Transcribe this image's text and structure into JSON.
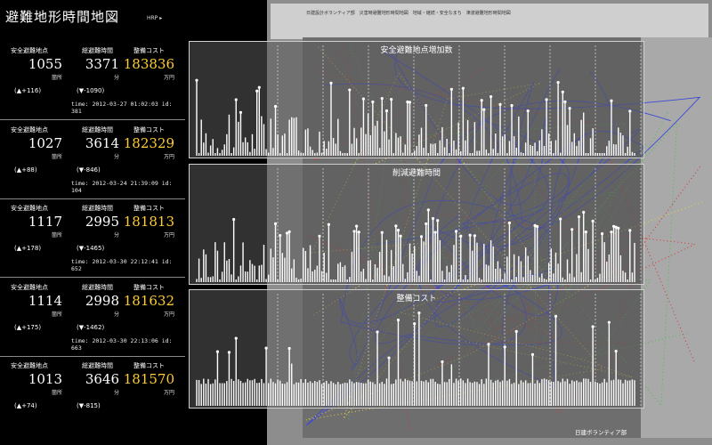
{
  "app": {
    "title": "避難地形時間地図",
    "subtitle": "HRP ▸"
  },
  "colors": {
    "accent": "#ffcc33",
    "bar": "#ffffff",
    "map_red": "#d93030",
    "map_blue": "#3b49d8",
    "map_green": "#48c048"
  },
  "labels": {
    "points": "安全避難地点",
    "time": "総避難時間",
    "cost": "整備コスト"
  },
  "units": {
    "points": "箇所",
    "time": "分",
    "cost": "万円"
  },
  "records": [
    {
      "points": "1055",
      "time": "3371",
      "cost": "183836",
      "delta_pos": "(▲+116)",
      "delta_neg": "(▼-1090)",
      "timestamp": "time: 2012-03-27 01:02:03 id: 381"
    },
    {
      "points": "1027",
      "time": "3614",
      "cost": "182329",
      "delta_pos": "(▲+88)",
      "delta_neg": "(▼-846)",
      "timestamp": "time: 2012-03-24 21:39:09 id: 104"
    },
    {
      "points": "1117",
      "time": "2995",
      "cost": "181813",
      "delta_pos": "(▲+178)",
      "delta_neg": "(▼-1465)",
      "timestamp": "time: 2012-03-30 22:12:41 id: 652"
    },
    {
      "points": "1114",
      "time": "2998",
      "cost": "181632",
      "delta_pos": "(▲+175)",
      "delta_neg": "(▼-1462)",
      "timestamp": "time: 2012-03-30 22:13:06 id: 663"
    },
    {
      "points": "1013",
      "time": "3646",
      "cost": "181570",
      "delta_pos": "(▲+74)",
      "delta_neg": "(▼-815)",
      "timestamp": ""
    }
  ],
  "charts": [
    {
      "title": "安全避難地点増加数"
    },
    {
      "title": "削減避難時間"
    },
    {
      "title": "整備コスト"
    }
  ],
  "chart_data": [
    {
      "type": "bar",
      "title": "安全避難地点増加数",
      "bar_count": 190
    },
    {
      "type": "bar",
      "title": "削減避難時間",
      "bar_count": 190
    },
    {
      "type": "bar",
      "title": "整備コスト",
      "bar_count": 190
    }
  ],
  "map": {
    "note": "日建設計ボランティア部　災害時避難地形時間地図　地域・継続・安全なまち　津波避難地形時間地図"
  },
  "credit": "日建ボランティア部"
}
